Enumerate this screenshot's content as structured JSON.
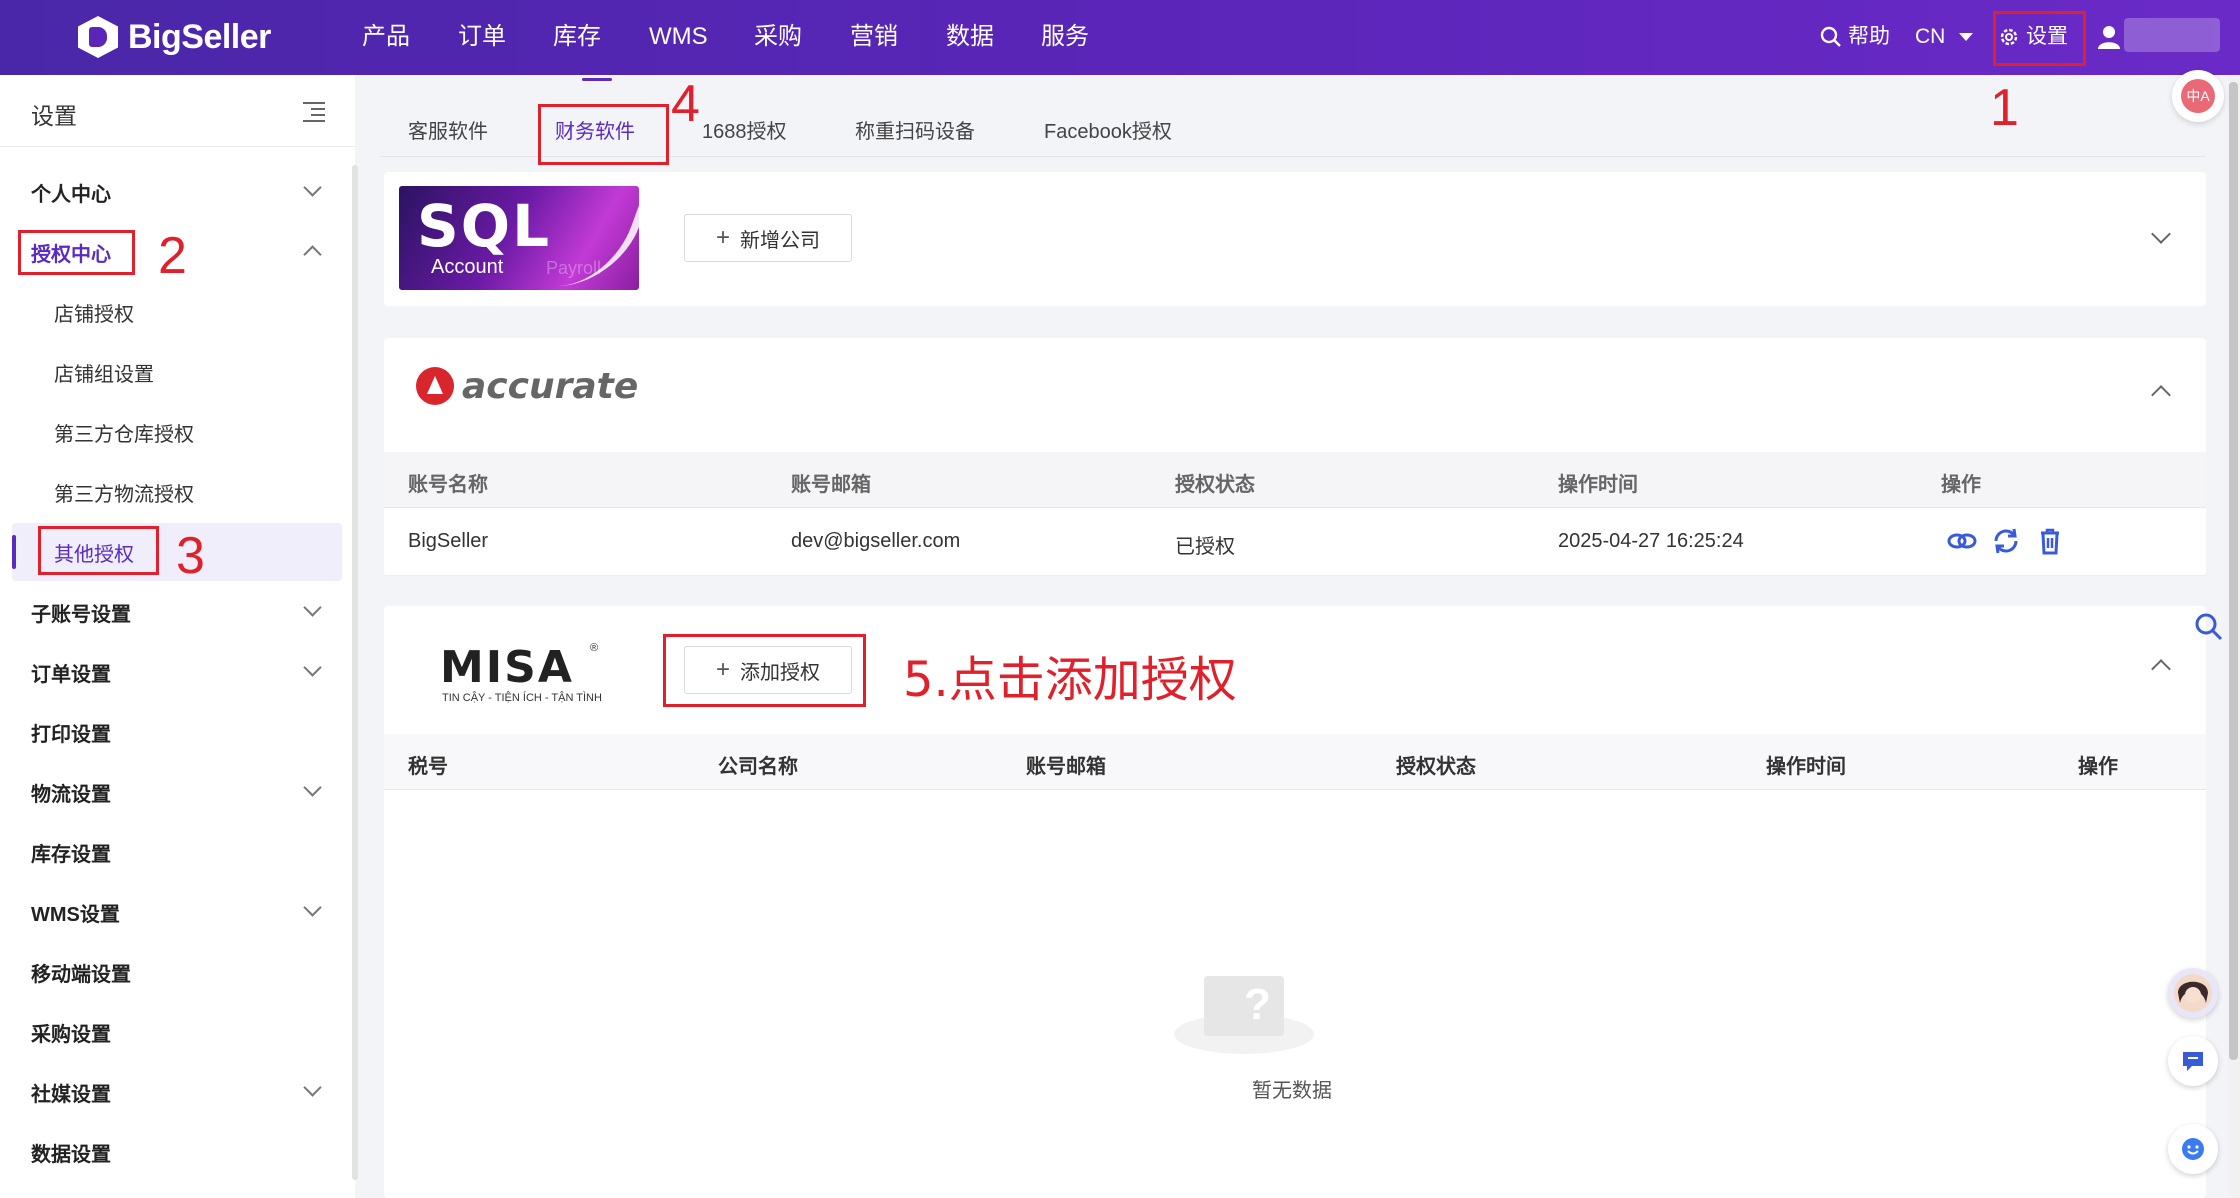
{
  "brand": {
    "name": "BigSeller"
  },
  "nav": {
    "items": [
      "产品",
      "订单",
      "库存",
      "WMS",
      "采购",
      "营销",
      "数据",
      "服务"
    ],
    "help": "帮助",
    "lang": "CN",
    "settings": "设置"
  },
  "sidebar": {
    "title": "设置",
    "items": [
      {
        "label": "个人中心"
      },
      {
        "label": "授权中心"
      },
      {
        "label": "店铺授权"
      },
      {
        "label": "店铺组设置"
      },
      {
        "label": "第三方仓库授权"
      },
      {
        "label": "第三方物流授权"
      },
      {
        "label": "其他授权"
      },
      {
        "label": "子账号设置"
      },
      {
        "label": "订单设置"
      },
      {
        "label": "打印设置"
      },
      {
        "label": "物流设置"
      },
      {
        "label": "库存设置"
      },
      {
        "label": "WMS设置"
      },
      {
        "label": "移动端设置"
      },
      {
        "label": "采购设置"
      },
      {
        "label": "社媒设置"
      },
      {
        "label": "数据设置"
      }
    ]
  },
  "tabs": [
    "客服软件",
    "财务软件",
    "1688授权",
    "称重扫码设备",
    "Facebook授权"
  ],
  "sql_card": {
    "logo_big": "SQL",
    "logo_small": "Account",
    "logo_faint": "Payroll",
    "button": "新增公司"
  },
  "accurate_card": {
    "logo": "accurate",
    "columns": [
      "账号名称",
      "账号邮箱",
      "授权状态",
      "操作时间",
      "操作"
    ],
    "rows": [
      {
        "name": "BigSeller",
        "email": "dev@bigseller.com",
        "status": "已授权",
        "time": "2025-04-27 16:25:24"
      }
    ]
  },
  "misa_card": {
    "logo": "MISA",
    "tagline": "TIN CẬY - TIỆN ÍCH - TẬN TÌNH",
    "registered": "®",
    "button": "添加授权",
    "columns": [
      "税号",
      "公司名称",
      "账号邮箱",
      "授权状态",
      "操作时间",
      "操作"
    ],
    "empty": "暂无数据"
  },
  "annotations": {
    "n1": "1",
    "n2": "2",
    "n3": "3",
    "n4": "4",
    "step5": "5.点击添加授权"
  },
  "colors": {
    "accent": "#5a2bc2",
    "annotation": "#e0202a",
    "link_icon": "#3a5bd9"
  }
}
